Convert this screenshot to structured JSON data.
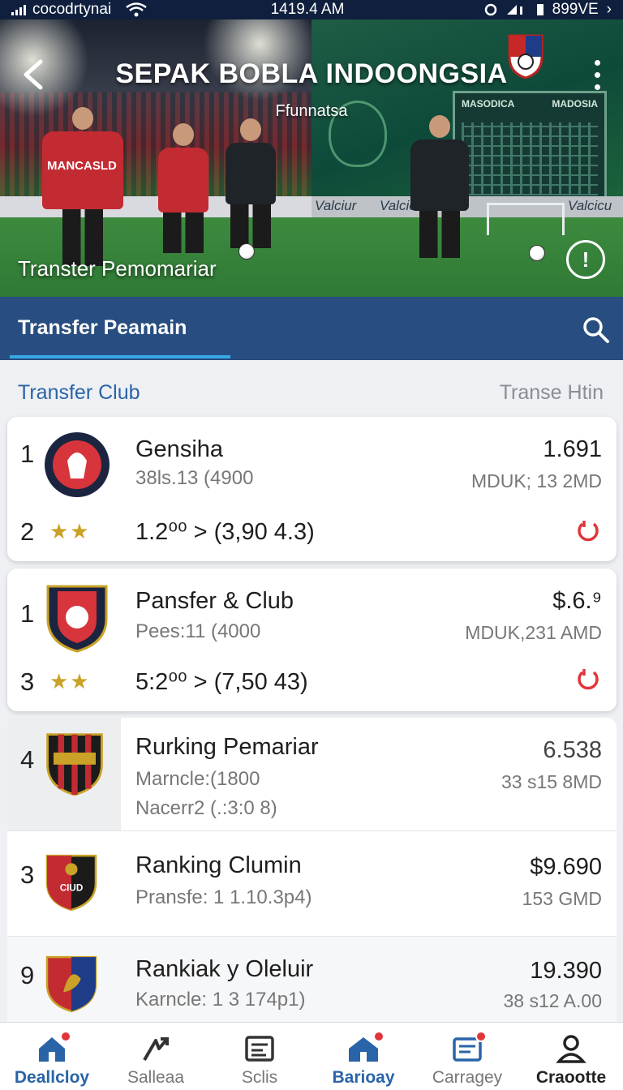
{
  "status_bar": {
    "carrier": "cocodrtynai",
    "time": "1419.4 AM",
    "battery": "899VE"
  },
  "hero": {
    "title": "SEPAK BOBLA INDOONGSIA",
    "subtitle": "Ffunnatsa",
    "caption": "Transter Pemomariar",
    "left_jersey_text": "MANCASLD",
    "scoreboard_left": "MASODICA",
    "scoreboard_right": "MADOSIA",
    "board_left": "Valciur",
    "board_center": "Valcicur",
    "board_right": "Valcicu"
  },
  "tab": {
    "label": "Transfer Peamain"
  },
  "section": {
    "title": "Transfer Club",
    "right_label": "Transe Htin"
  },
  "entries": [
    {
      "rank": "1",
      "name": "Gensiha",
      "meta": "38ls.13 (4900",
      "value": "1.691",
      "sub": "MDUK; 13 2MD",
      "rank2": "2",
      "stars": "★★",
      "stat": "1.2⁰⁰ > (3,90 4.3)"
    },
    {
      "rank": "1",
      "name": "Pansfer & Club",
      "meta": "Pees:11 (4000",
      "value": "$.6.⁹",
      "sub": "MDUK,231 AMD",
      "rank2": "3",
      "stars": "★★",
      "stat": "5:2⁰⁰ > (7,50 43)"
    },
    {
      "rank": "4",
      "name": "Rurking Pemariar",
      "meta": "Marncle:(1800",
      "meta2": "Nacerr2 (.:3:0 8)",
      "value": "6.538",
      "sub": "33 s15 8MD"
    },
    {
      "rank": "3",
      "name": "Ranking Clumin",
      "meta": "Pransfe: 1 1.10.3p4)",
      "value": "$9.690",
      "sub": "153 GMD",
      "crest_text": "CIUD"
    },
    {
      "rank": "9",
      "name": "Rankiak y Oleluir",
      "meta": "Karncle: 1 3 174p1)",
      "value": "19.390",
      "sub": "38 s12 A.00"
    }
  ],
  "bottom_nav": [
    {
      "label": "Deallcloy",
      "icon": "home-icon"
    },
    {
      "label": "Salleaa",
      "icon": "arrow-icon"
    },
    {
      "label": "Sclis",
      "icon": "list-icon"
    },
    {
      "label": "Barioay",
      "icon": "home-icon"
    },
    {
      "label": "Carragey",
      "icon": "calendar-icon"
    },
    {
      "label": "Craootte",
      "icon": "person-icon"
    }
  ],
  "colors": {
    "tab_bar": "#284d80",
    "accent": "#2a64a8",
    "underline": "#36a8e4",
    "alert_red": "#e0353a",
    "star_gold": "#c9a227"
  }
}
